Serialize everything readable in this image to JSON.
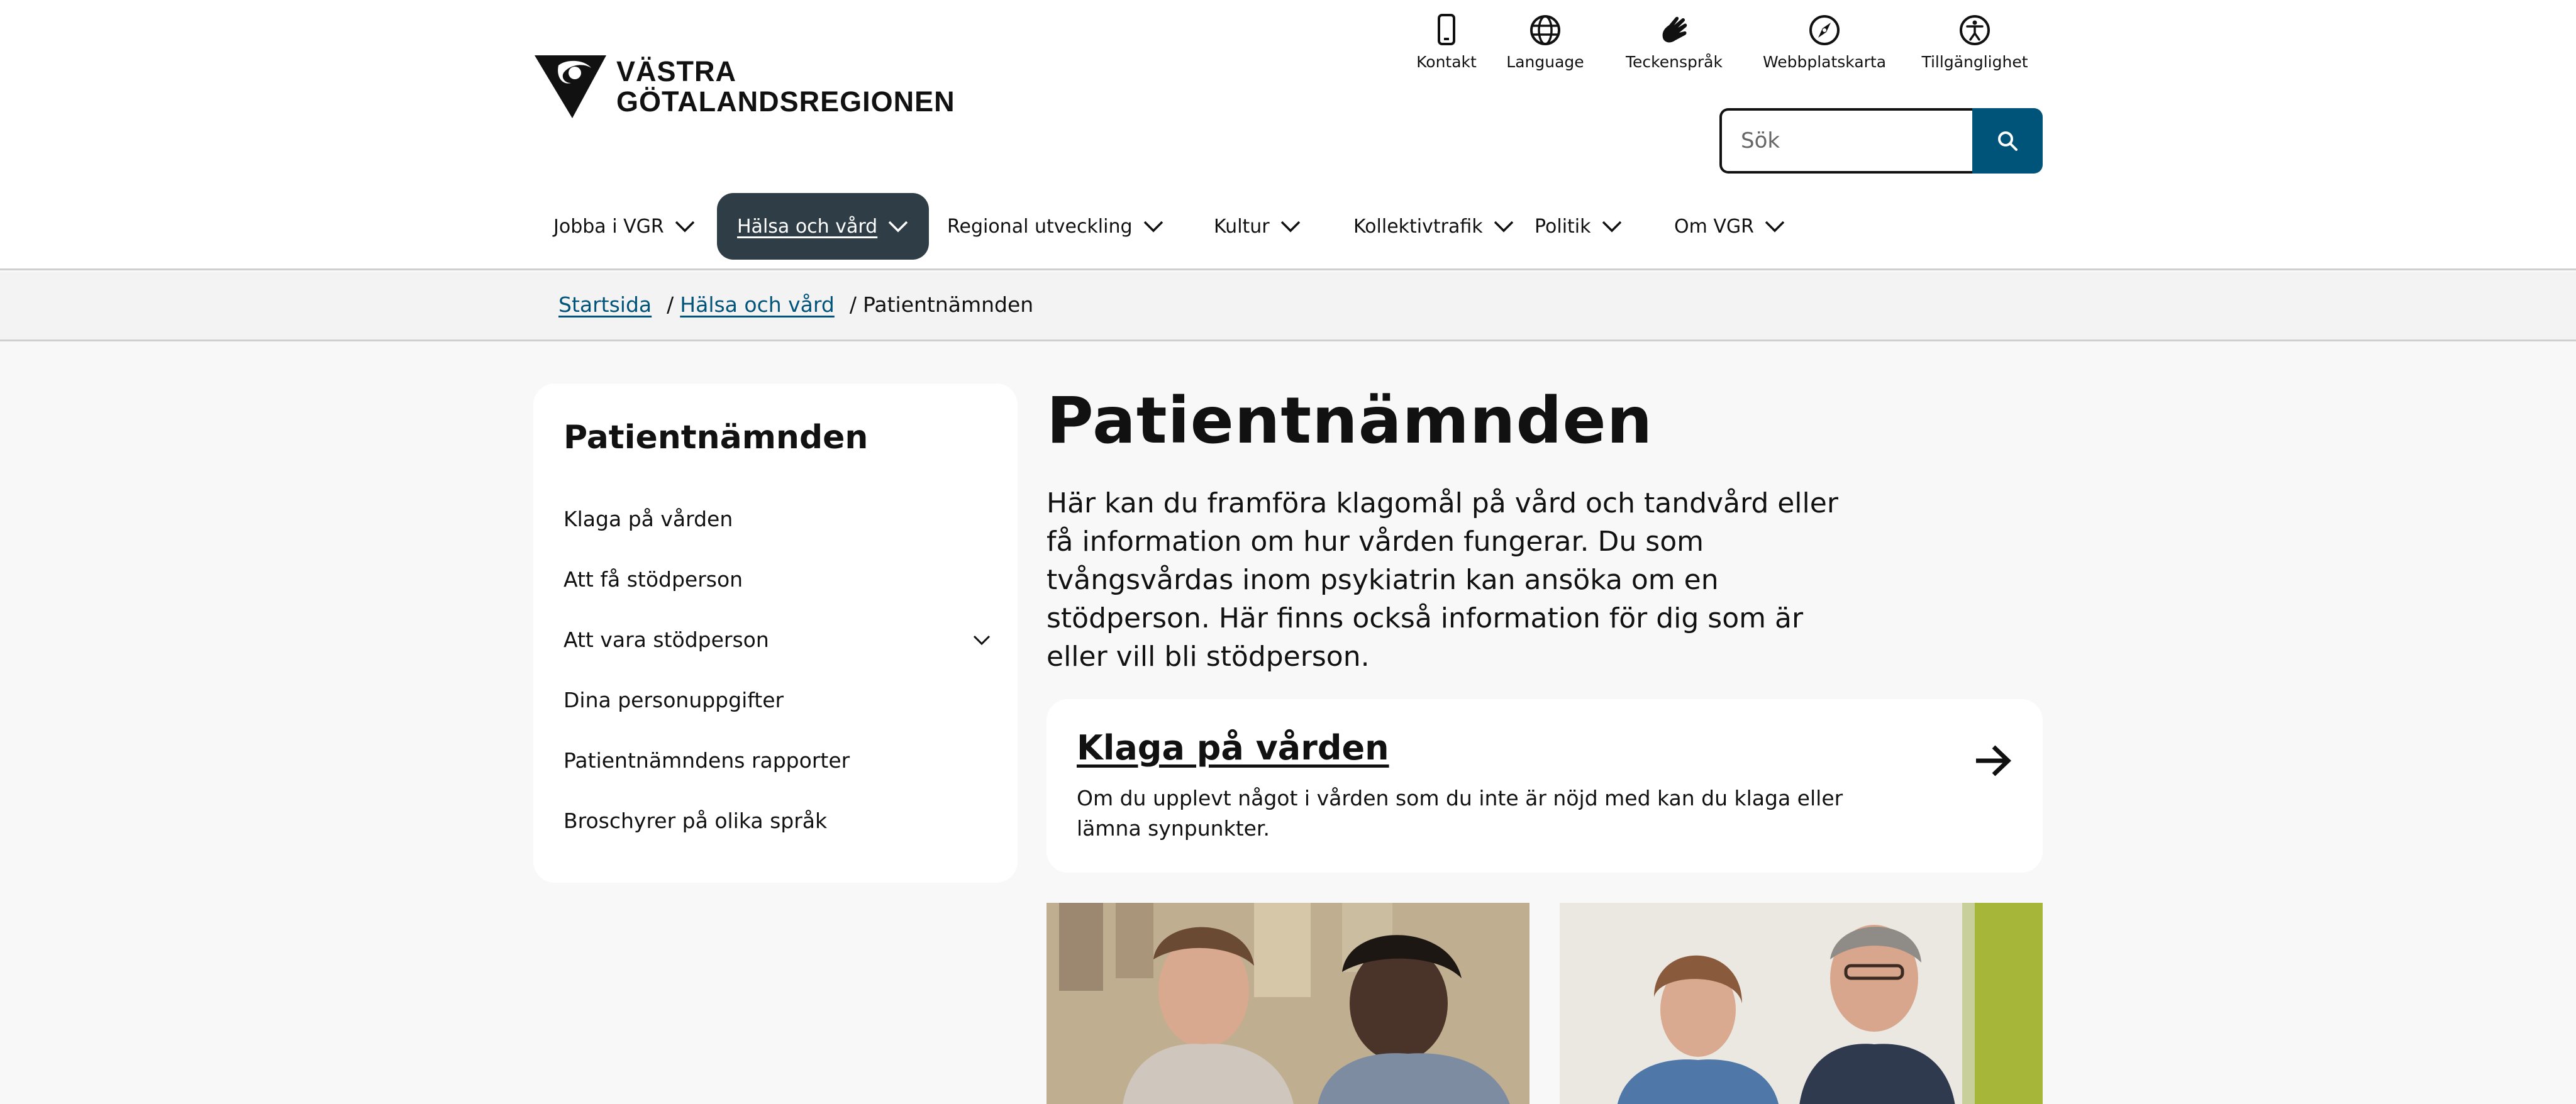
{
  "logo": {
    "line1": "VÄSTRA",
    "line2": "GÖTALANDSREGIONEN"
  },
  "utility": [
    {
      "label": "Kontakt",
      "icon": "phone-icon"
    },
    {
      "label": "Language",
      "icon": "globe-icon"
    },
    {
      "label": "Teckenspråk",
      "icon": "sign-language-icon"
    },
    {
      "label": "Webbplatskarta",
      "icon": "compass-icon"
    },
    {
      "label": "Tillgänglighet",
      "icon": "accessibility-icon"
    }
  ],
  "search": {
    "placeholder": "Sök",
    "icon": "search-icon"
  },
  "nav": [
    {
      "label": "Jobba i VGR"
    },
    {
      "label": "Hälsa och vård",
      "active": true
    },
    {
      "label": "Regional utveckling"
    },
    {
      "label": "Kultur"
    },
    {
      "label": "Kollektivtrafik"
    },
    {
      "label": "Politik"
    },
    {
      "label": "Om VGR"
    }
  ],
  "breadcrumb": {
    "home": "Startsida",
    "section": "Hälsa och vård",
    "current": "Patientnämnden",
    "separator": "/"
  },
  "sidebar": {
    "title": "Patientnämnden",
    "items": [
      {
        "label": "Klaga på vården"
      },
      {
        "label": "Att få stödperson"
      },
      {
        "label": "Att vara stödperson",
        "expandable": true
      },
      {
        "label": "Dina personuppgifter"
      },
      {
        "label": "Patientnämndens rapporter"
      },
      {
        "label": "Broschyrer på olika språk"
      }
    ]
  },
  "main": {
    "title": "Patientnämnden",
    "intro": "Här kan du framföra klagomål på vård och tandvård eller få information om hur vården fungerar. Du som tvångsvårdas inom psykiatrin kan ansöka om en stödperson. Här finns också information för dig som är eller vill bli stödperson.",
    "card": {
      "title": "Klaga på vården",
      "description": "Om du upplevt något i vården som du inte är nöjd med kan du klaga eller lämna synpunkter.",
      "icon": "arrow-right-icon"
    }
  },
  "colors": {
    "brand_blue": "#00547a",
    "nav_active": "#2f3e46"
  }
}
